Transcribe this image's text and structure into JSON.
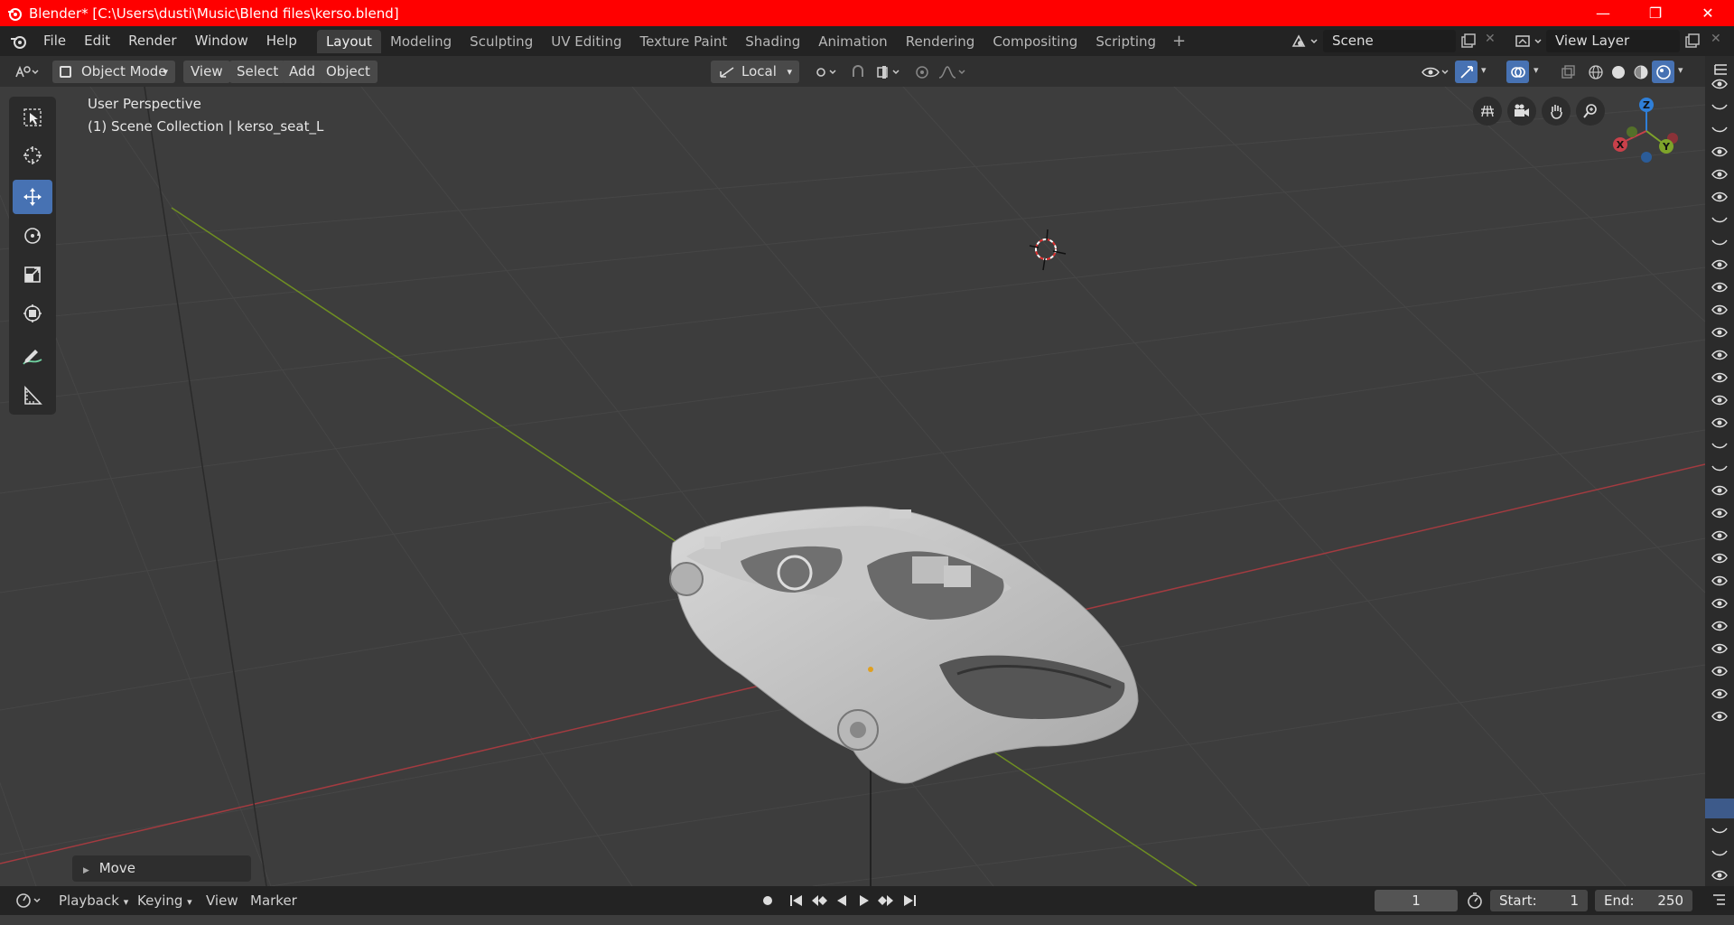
{
  "window": {
    "title": "Blender* [C:\\Users\\dusti\\Music\\Blend files\\kerso.blend]",
    "min_symbol": "—",
    "max_symbol": "❐",
    "close_symbol": "✕"
  },
  "menu": {
    "items": [
      "File",
      "Edit",
      "Render",
      "Window",
      "Help"
    ]
  },
  "workspaces": {
    "tabs": [
      "Layout",
      "Modeling",
      "Sculpting",
      "UV Editing",
      "Texture Paint",
      "Shading",
      "Animation",
      "Rendering",
      "Compositing",
      "Scripting"
    ],
    "active": "Layout",
    "add_symbol": "+"
  },
  "scene": {
    "name": "Scene",
    "view_layer": "View Layer"
  },
  "viewport_header": {
    "mode": "Object Mode",
    "view": "View",
    "select": "Select",
    "add": "Add",
    "object": "Object",
    "transform_orientation": "Local"
  },
  "viewport": {
    "perspective_label": "User Perspective",
    "collection_label": "(1) Scene Collection | kerso_seat_L",
    "gizmo": {
      "x": "X",
      "y": "Y",
      "z": "Z"
    }
  },
  "last_operator": {
    "label": "Move"
  },
  "timeline": {
    "playback": "Playback",
    "keying": "Keying",
    "view": "View",
    "marker": "Marker",
    "current_frame": "1",
    "start_label": "Start:",
    "start_value": "1",
    "end_label": "End:",
    "end_value": "250"
  },
  "colors": {
    "title_bar": "#ff0000",
    "accent": "#4772b3",
    "axis_x": "#c8404a",
    "axis_y": "#7ea32a",
    "axis_z": "#2f7fd8"
  }
}
